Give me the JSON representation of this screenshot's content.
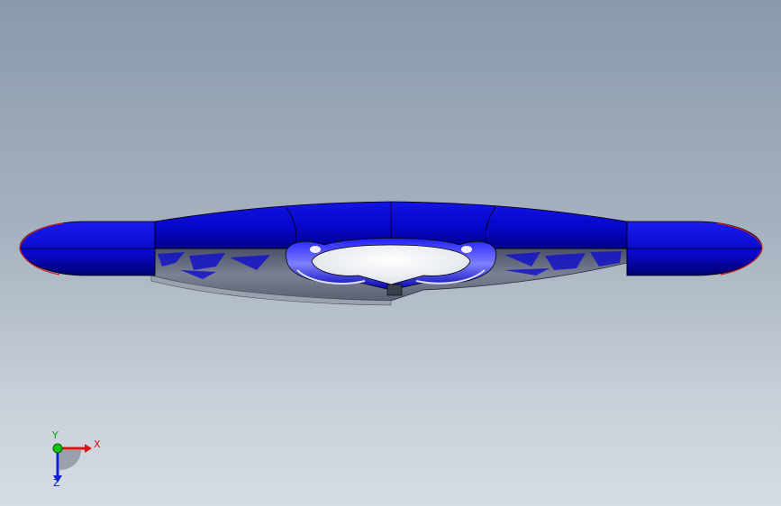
{
  "viewport": {
    "background_top": "#8a9aac",
    "background_bottom": "#d6dce3"
  },
  "model": {
    "part_color": "#0a0ad8",
    "highlight_color": "#6a6aff",
    "edge_color": "#000000",
    "silhouette_accent": "#c0202a",
    "underside_color": "#707684"
  },
  "triad": {
    "x_label": "X",
    "y_label": "Y",
    "z_label": "Z",
    "x_color": "#e01010",
    "y_color": "#10c010",
    "z_color": "#1020d0"
  }
}
